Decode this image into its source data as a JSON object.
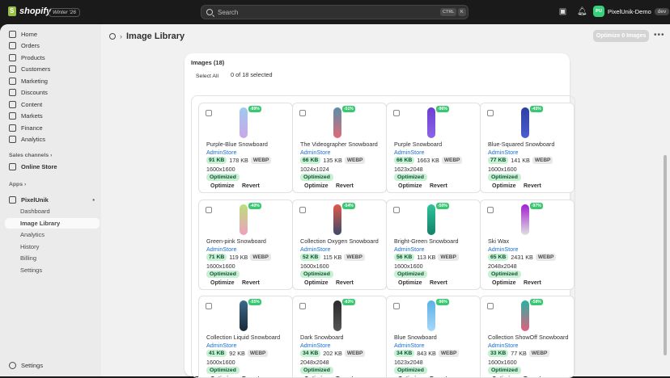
{
  "topbar": {
    "brand": "shopify",
    "edition": "Winter '26",
    "search_placeholder": "Search",
    "kbd_ctrl": "CTRL",
    "kbd_k": "K",
    "store_initials": "PU",
    "store_name": "PixelUnik-Demo",
    "store_tag": "dev"
  },
  "sidebar": {
    "items": [
      {
        "label": "Home",
        "icon": "home-icon"
      },
      {
        "label": "Orders",
        "icon": "orders-icon"
      },
      {
        "label": "Products",
        "icon": "tag-icon"
      },
      {
        "label": "Customers",
        "icon": "person-icon"
      },
      {
        "label": "Marketing",
        "icon": "target-icon"
      },
      {
        "label": "Discounts",
        "icon": "discount-icon"
      },
      {
        "label": "Content",
        "icon": "content-icon"
      },
      {
        "label": "Markets",
        "icon": "globe-icon"
      },
      {
        "label": "Finance",
        "icon": "bank-icon"
      },
      {
        "label": "Analytics",
        "icon": "chart-icon"
      }
    ],
    "sales_channels_label": "Sales channels",
    "online_store_label": "Online Store",
    "apps_label": "Apps",
    "app_name": "PixelUnik",
    "app_items": [
      "Dashboard",
      "Image Library",
      "Analytics",
      "History",
      "Billing",
      "Settings"
    ],
    "settings_label": "Settings"
  },
  "page": {
    "title": "Image Library",
    "optimize_button": "Optimize 0 Images",
    "images_count": "Images (18)",
    "select_all": "Select All",
    "selected_info": "0 of 18 selected"
  },
  "tiles": [
    {
      "name": "Purple-Blue Snowboard",
      "store": "AdminStore",
      "pct": "-89%",
      "new": "91 KB",
      "old": "178 KB",
      "fmt": "WEBP",
      "dims": "1600x1600",
      "status": "Optimized",
      "a1": "Optimize",
      "a2": "Revert",
      "c1": "#9ec9ee",
      "c2": "#c9a8e8"
    },
    {
      "name": "The Videographer Snowboard",
      "store": "AdminStore",
      "pct": "-51%",
      "new": "66 KB",
      "old": "135 KB",
      "fmt": "WEBP",
      "dims": "1024x1024",
      "status": "Optimized",
      "a1": "Optimize",
      "a2": "Revert",
      "c1": "#5a8fa8",
      "c2": "#e06b78"
    },
    {
      "name": "Purple Snowboard",
      "store": "AdminStore",
      "pct": "-96%",
      "new": "66 KB",
      "old": "1663 KB",
      "fmt": "WEBP",
      "dims": "1623x2048",
      "status": "Optimized",
      "a1": "Optimize",
      "a2": "Revert",
      "c1": "#6b3fd1",
      "c2": "#8c64e8"
    },
    {
      "name": "Blue-Squared Snowboard",
      "store": "AdminStore",
      "pct": "-45%",
      "new": "77 KB",
      "old": "141 KB",
      "fmt": "WEBP",
      "dims": "1600x1600",
      "status": "Optimized",
      "a1": "Optimize",
      "a2": "Revert",
      "c1": "#2d3fa0",
      "c2": "#4a5fd0"
    },
    {
      "name": "Green-pink Snowboard",
      "store": "AdminStore",
      "pct": "-40%",
      "new": "71 KB",
      "old": "119 KB",
      "fmt": "WEBP",
      "dims": "1600x1600",
      "status": "Optimized",
      "a1": "Optimize",
      "a2": "Revert",
      "c1": "#b9e07a",
      "c2": "#f0a0c0"
    },
    {
      "name": "Collection Oxygen Snowboard",
      "store": "AdminStore",
      "pct": "-54%",
      "new": "52 KB",
      "old": "115 KB",
      "fmt": "WEBP",
      "dims": "1600x1600",
      "status": "Optimized",
      "a1": "Optimize",
      "a2": "Revert",
      "c1": "#e05a48",
      "c2": "#3a4a6a"
    },
    {
      "name": "Bright-Green Snowboard",
      "store": "AdminStore",
      "pct": "-50%",
      "new": "56 KB",
      "old": "113 KB",
      "fmt": "WEBP",
      "dims": "1600x1600",
      "status": "Optimized",
      "a1": "Optimize",
      "a2": "Revert",
      "c1": "#2fc59a",
      "c2": "#15806a"
    },
    {
      "name": "Ski Wax",
      "store": "AdminStore",
      "pct": "-97%",
      "new": "65 KB",
      "old": "2431 KB",
      "fmt": "WEBP",
      "dims": "2048x2048",
      "status": "Optimized",
      "a1": "Optimize",
      "a2": "Revert",
      "c1": "#a020d0",
      "c2": "#e0e0e0"
    },
    {
      "name": "Collection Liquid Snowboard",
      "store": "AdminStore",
      "pct": "-55%",
      "new": "41 KB",
      "old": "92 KB",
      "fmt": "WEBP",
      "dims": "1600x1600",
      "status": "Optimized",
      "a1": "Optimize",
      "a2": "Revert",
      "c1": "#3a6a8a",
      "c2": "#1a2a3a"
    },
    {
      "name": "Dark Snowboard",
      "store": "AdminStore",
      "pct": "-83%",
      "new": "34 KB",
      "old": "202 KB",
      "fmt": "WEBP",
      "dims": "2048x2048",
      "status": "Optimized",
      "a1": "Optimize",
      "a2": "Revert",
      "c1": "#2a2a2a",
      "c2": "#555555"
    },
    {
      "name": "Blue Snowboard",
      "store": "AdminStore",
      "pct": "-96%",
      "new": "34 KB",
      "old": "843 KB",
      "fmt": "WEBP",
      "dims": "1623x2048",
      "status": "Optimized",
      "a1": "Optimize",
      "a2": "Revert",
      "c1": "#5ab0e8",
      "c2": "#a8d8f8"
    },
    {
      "name": "Collection ShowOff Snowboard",
      "store": "AdminStore",
      "pct": "-58%",
      "new": "33 KB",
      "old": "77 KB",
      "fmt": "WEBP",
      "dims": "1600x1600",
      "status": "Optimized",
      "a1": "Optimize",
      "a2": "Revert",
      "c1": "#2ab0a0",
      "c2": "#e06080"
    }
  ]
}
